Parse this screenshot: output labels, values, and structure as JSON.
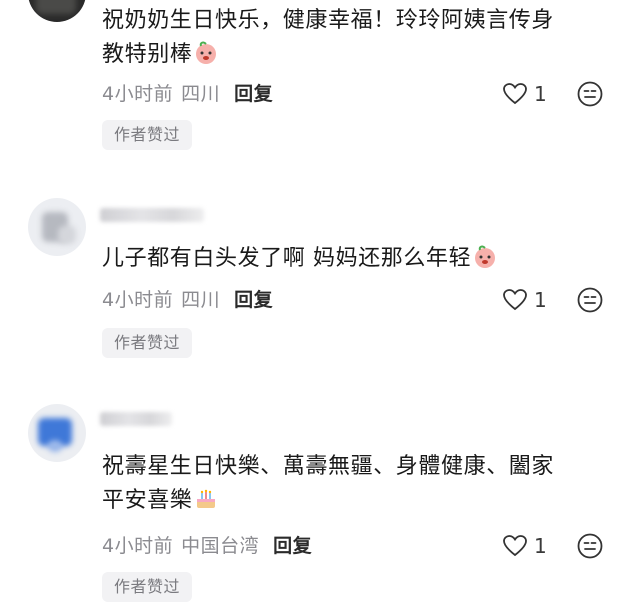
{
  "comments": [
    {
      "text_line1": "祝奶奶生日快乐，健康幸福！玲玲阿姨言传身",
      "text_line2": "教特别棒",
      "emoji": "peach-face-emoji",
      "time": "4小时前",
      "location": "四川",
      "reply": "回复",
      "likes": "1",
      "badge": "作者赞过"
    },
    {
      "text_line1": "儿子都有白头发了啊 妈妈还那么年轻",
      "emoji": "peach-face-emoji",
      "time": "4小时前",
      "location": "四川",
      "reply": "回复",
      "likes": "1",
      "badge": "作者赞过"
    },
    {
      "text_line1": "祝壽星生日快樂、萬壽無疆、身體健康、闔家",
      "text_line2": "平安喜樂",
      "emoji": "birthday-cake-emoji",
      "time": "4小时前",
      "location": "中国台湾",
      "reply": "回复",
      "likes": "1",
      "badge": "作者赞过"
    }
  ],
  "colors": {
    "text": "#1a1a1a",
    "meta": "#8b8b90",
    "badge_bg": "#f2f2f4",
    "peach": "#f5a3a0"
  }
}
